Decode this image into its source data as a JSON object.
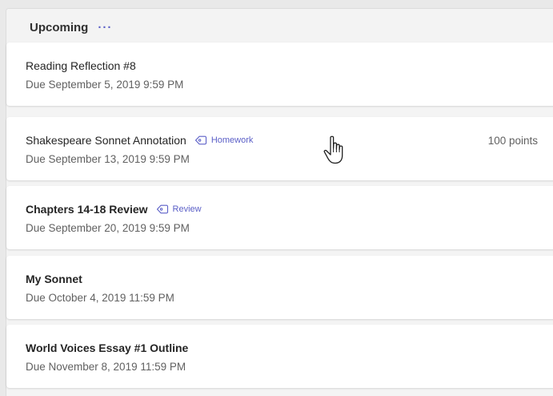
{
  "header": {
    "title": "Upcoming",
    "more_label": "···"
  },
  "assignments": [
    {
      "title": "Reading Reflection #8",
      "due": "Due September 5, 2019 9:59 PM",
      "bold": false,
      "tag": null,
      "points": null
    },
    {
      "title": "Shakespeare Sonnet Annotation",
      "due": "Due September 13, 2019 9:59 PM",
      "bold": false,
      "tag": "Homework",
      "points": "100 points"
    },
    {
      "title": "Chapters 14-18 Review",
      "due": "Due September 20, 2019 9:59 PM",
      "bold": true,
      "tag": "Review",
      "points": null
    },
    {
      "title": "My Sonnet",
      "due": "Due October 4, 2019 11:59 PM",
      "bold": true,
      "tag": null,
      "points": null
    },
    {
      "title": "World Voices Essay #1 Outline",
      "due": "Due November 8, 2019 11:59 PM",
      "bold": true,
      "tag": null,
      "points": null
    }
  ],
  "icons": {
    "tag": "tag-icon",
    "cursor": "hand-pointer-icon"
  },
  "colors": {
    "accent": "#5b5fc7",
    "title_text": "#252525",
    "secondary_text": "#616161",
    "card_bg": "#ffffff",
    "page_bg": "#f4f4f4"
  }
}
